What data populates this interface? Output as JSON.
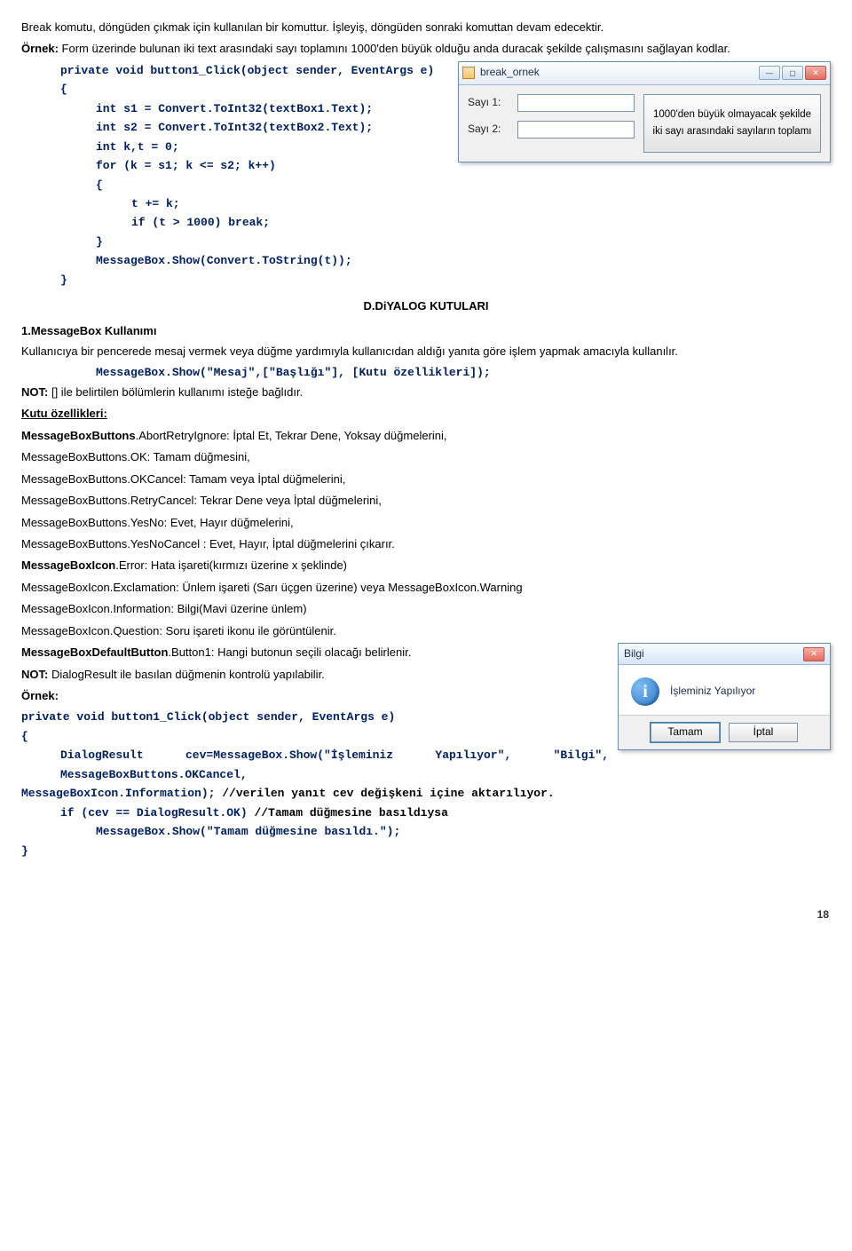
{
  "intro": {
    "p1": "Break komutu, döngüden çıkmak için kullanılan bir komuttur. İşleyiş, döngüden sonraki komuttan devam edecektir.",
    "ex_label": "Örnek:",
    "ex_text": " Form üzerinde bulunan iki text arasındaki sayı toplamını 1000'den büyük olduğu anda duracak şekilde çalışmasını sağlayan kodlar."
  },
  "codeA": {
    "l0": "private void button1_Click(object sender, EventArgs e)",
    "l1": "{",
    "l2": "int s1 = Convert.ToInt32(textBox1.Text);",
    "l3": "int s2 = Convert.ToInt32(textBox2.Text);",
    "l4": "int k,t = 0;",
    "l5": "for (k = s1; k <= s2; k++)",
    "l6": "{",
    "l7": "t += k;",
    "l8": "if (t > 1000) break;",
    "l9": "}",
    "l10": "MessageBox.Show(Convert.ToString(t));",
    "l11": "}"
  },
  "winBreak": {
    "title": "break_ornek",
    "label1": "Sayı 1:",
    "label2": "Sayı 2:",
    "button": "1000'den büyük olmayacak şekilde iki sayı arasındaki sayıların toplamı"
  },
  "heading": "D.DiYALOG KUTULARI",
  "mb": {
    "sub1": "1.MessageBox Kullanımı",
    "p1": "Kullanıcıya bir pencerede mesaj vermek veya düğme yardımıyla kullanıcıdan aldığı yanıta göre işlem yapmak amacıyla kullanılır.",
    "code1": "MessageBox.Show(\"Mesaj\",[\"Başlığı\"], [Kutu özellikleri]);",
    "not1_label": "NOT:",
    "not1_text": " [] ile belirtilen bölümlerin kullanımı isteğe bağlıdır.",
    "props": "Kutu özellikleri:",
    "r1a": "MessageBoxButtons",
    "r1b": ".AbortRetryIgnore: İptal Et, Tekrar Dene, Yoksay düğmelerini,",
    "r2": "MessageBoxButtons.OK: Tamam düğmesini,",
    "r3": "MessageBoxButtons.OKCancel: Tamam veya İptal düğmelerini,",
    "r4": "MessageBoxButtons.RetryCancel: Tekrar Dene veya İptal düğmelerini,",
    "r5": "MessageBoxButtons.YesNo: Evet, Hayır düğmelerini,",
    "r6": "MessageBoxButtons.YesNoCancel : Evet, Hayır, İptal düğmelerini çıkarır.",
    "r7a": "MessageBoxIcon",
    "r7b": ".Error: Hata işareti(kırmızı üzerine x şeklinde)",
    "r8": "MessageBoxIcon.Exclamation: Ünlem işareti (Sarı üçgen üzerine) veya MessageBoxIcon.Warning",
    "r9": "MessageBoxIcon.Information: Bilgi(Mavi üzerine ünlem)",
    "r10": "MessageBoxIcon.Question: Soru işareti ikonu ile görüntülenir.",
    "r11a": "MessageBoxDefaultButton",
    "r11b": ".Button1: Hangi butonun seçili olacağı belirlenir.",
    "not2_label": "NOT:",
    "not2_text": " DialogResult ile basılan düğmenin kontrolü yapılabilir.",
    "ex2_label": "Örnek:"
  },
  "winBilgi": {
    "title": "Bilgi",
    "msg": "İşleminiz Yapılıyor",
    "ok": "Tamam",
    "cancel": "İptal"
  },
  "codeB": {
    "l0": "private void button1_Click(object sender, EventArgs e)",
    "l1": "{",
    "l2a": "DialogResult  cev=MessageBox.Show(\"İşleminiz  Yapılıyor\",  \"Bilgi\",  MessageBoxButtons.OKCancel,",
    "l2b": "MessageBoxIcon.Information);",
    "l2c": " //verilen yanıt cev değişkeni içine aktarılıyor.",
    "l3a": "if (cev == DialogResult.OK)",
    "l3b": " //Tamam düğmesine basıldıysa",
    "l4": "MessageBox.Show(\"Tamam düğmesine basıldı.\");",
    "l5": "}"
  },
  "page": "18"
}
